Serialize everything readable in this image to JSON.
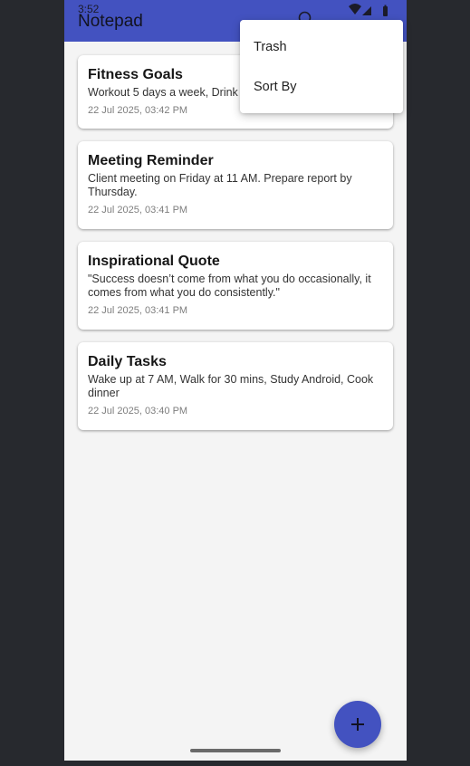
{
  "status_bar": {
    "time": "3:52"
  },
  "app_bar": {
    "title": "Notepad"
  },
  "menu": {
    "items": [
      {
        "label": "Trash"
      },
      {
        "label": "Sort By"
      }
    ]
  },
  "notes": [
    {
      "title": "Fitness Goals",
      "body": "Workout 5 days a week, Drink",
      "date": "22 Jul 2025, 03:42 PM"
    },
    {
      "title": "Meeting Reminder",
      "body": "Client meeting on Friday at 11 AM. Prepare report by Thursday.",
      "date": "22 Jul 2025, 03:41 PM"
    },
    {
      "title": "Inspirational Quote",
      "body": "\"Success doesn’t come from what you do occasionally, it comes from what you do consistently.\"",
      "date": "22 Jul 2025, 03:41 PM"
    },
    {
      "title": "Daily Tasks",
      "body": "Wake up at 7 AM, Walk for 30 mins, Study Android, Cook dinner",
      "date": "22 Jul 2025, 03:40 PM"
    }
  ],
  "fab": {
    "icon": "plus-icon"
  },
  "colors": {
    "primary": "#4352c0",
    "background": "#f4f4f4",
    "frame": "#27292e"
  }
}
